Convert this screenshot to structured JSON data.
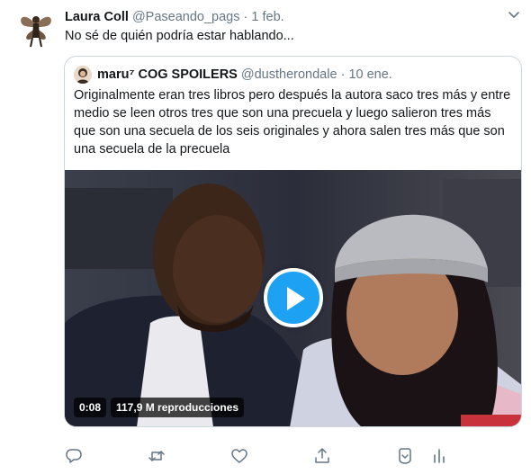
{
  "tweet": {
    "author_name": "Laura Coll",
    "author_handle": "@Paseando_pags",
    "separator": "·",
    "date": "1 feb.",
    "text": "No sé de quién podría estar hablando..."
  },
  "quoted": {
    "author_name": "maru⁷ COG SPOILERS",
    "author_handle": "@dustherondale",
    "separator": "·",
    "date": "10 ene.",
    "text": "Originalmente eran tres libros pero después la autora saco tres más y entre medio se leen otros tres que son una precuela y luego salieron tres más que son una secuela de los seis originales y ahora salen tres más que son una secuela de la precuela",
    "video": {
      "duration": "0:08",
      "views": "117,9 M reproducciones"
    }
  },
  "actions": {
    "icons": [
      "reply-icon",
      "retweet-icon",
      "like-icon",
      "share-icon",
      "bookmark-icon",
      "analytics-icon"
    ]
  },
  "colors": {
    "accent": "#1da1f2",
    "text": "#14171a",
    "secondary": "#657786",
    "border": "#ccd6dd"
  }
}
